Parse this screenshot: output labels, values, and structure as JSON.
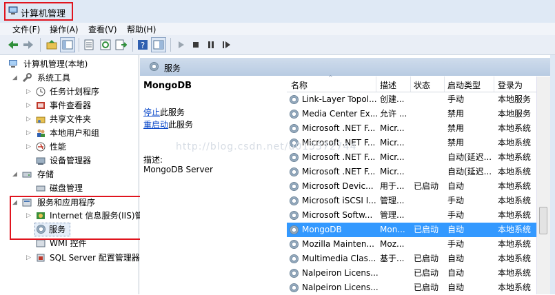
{
  "window": {
    "title": "计算机管理"
  },
  "menu": [
    "文件(F)",
    "操作(A)",
    "查看(V)",
    "帮助(H)"
  ],
  "tree": {
    "root": "计算机管理(本地)",
    "system_tools": "系统工具",
    "task_scheduler": "任务计划程序",
    "event_viewer": "事件查看器",
    "shared_folders": "共享文件夹",
    "local_users": "本地用户和组",
    "performance": "性能",
    "device_manager": "设备管理器",
    "storage": "存储",
    "disk_management": "磁盘管理",
    "services_apps": "服务和应用程序",
    "iis": "Internet 信息服务(IIS)管",
    "services": "服务",
    "wmi": "WMI 控件",
    "sql": "SQL Server 配置管理器"
  },
  "pane": {
    "title": "服务",
    "service_name": "MongoDB",
    "stop_link": "停止",
    "stop_suffix": "此服务",
    "restart_link": "重启动",
    "restart_suffix": "此服务",
    "desc_label": "描述:",
    "desc_value": "MongoDB Server"
  },
  "list": {
    "columns": [
      "名称",
      "描述",
      "状态",
      "启动类型",
      "登录为"
    ],
    "rows": [
      [
        "Link-Layer Topol...",
        "创建...",
        "",
        "手动",
        "本地服务"
      ],
      [
        "Media Center Ex...",
        "允许 ...",
        "",
        "禁用",
        "本地服务"
      ],
      [
        "Microsoft .NET F...",
        "Micr...",
        "",
        "禁用",
        "本地系统"
      ],
      [
        "Microsoft .NET F...",
        "Micr...",
        "",
        "禁用",
        "本地系统"
      ],
      [
        "Microsoft .NET F...",
        "Micr...",
        "",
        "自动(延迟...",
        "本地系统"
      ],
      [
        "Microsoft .NET F...",
        "Micr...",
        "",
        "自动(延迟...",
        "本地系统"
      ],
      [
        "Microsoft Devic...",
        "用于...",
        "已启动",
        "自动",
        "本地系统"
      ],
      [
        "Microsoft iSCSI I...",
        "管理...",
        "",
        "手动",
        "本地系统"
      ],
      [
        "Microsoft Softw...",
        "管理...",
        "",
        "手动",
        "本地系统"
      ],
      [
        "MongoDB",
        "Mon...",
        "已启动",
        "自动",
        "本地系统"
      ],
      [
        "Mozilla Mainten...",
        "Moz...",
        "",
        "手动",
        "本地系统"
      ],
      [
        "Multimedia Clas...",
        "基于...",
        "已启动",
        "自动",
        "本地系统"
      ],
      [
        "Nalpeiron Licens...",
        "",
        "已启动",
        "自动",
        "本地系统"
      ],
      [
        "Nalpeiron Licens...",
        "",
        "已启动",
        "自动",
        "本地系统"
      ]
    ],
    "selected_index": 9
  },
  "watermark": "http://blog.csdn.net/u013372744"
}
